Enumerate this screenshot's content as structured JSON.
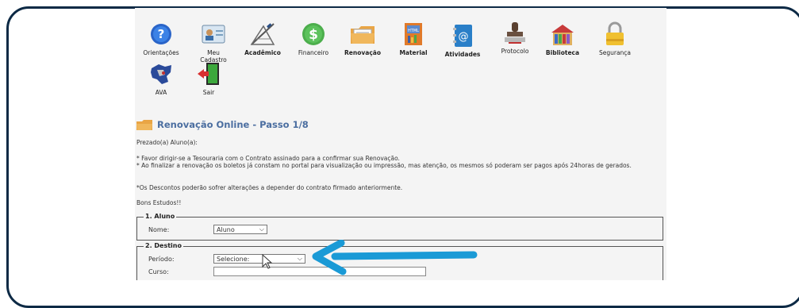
{
  "nav": {
    "items": [
      {
        "label": "Orientações",
        "icon": "help-icon"
      },
      {
        "label": "Meu Cadastro",
        "icon": "id-card-icon"
      },
      {
        "label": "Acadêmico",
        "icon": "drafting-icon"
      },
      {
        "label": "Financeiro",
        "icon": "dollar-icon"
      },
      {
        "label": "Renovação",
        "icon": "folder-icon"
      },
      {
        "label": "Material",
        "icon": "html-book-icon"
      },
      {
        "label": "Atividades",
        "icon": "address-book-icon"
      },
      {
        "label": "Protocolo",
        "icon": "stamp-icon"
      },
      {
        "label": "Biblioteca",
        "icon": "books-icon"
      },
      {
        "label": "Segurança",
        "icon": "padlock-icon"
      },
      {
        "label": "AVA",
        "icon": "map-icon"
      },
      {
        "label": "Sair",
        "icon": "exit-door-icon"
      }
    ]
  },
  "page": {
    "title": "Renovação Online - Passo 1/8",
    "greeting": "Prezado(a) Aluno(a):",
    "notice1": "* Favor dirigir-se a Tesouraria com o Contrato assinado para a confirmar sua Renovação.",
    "notice2": "* Ao finalizar a renovação os boletos já constam no portal para visualização ou impressão, mas atenção, os mesmos só poderam ser pagos após 24horas de gerados.",
    "notice3": "*Os Descontos poderão sofrer alterações a depender do contrato firmado anteriormente.",
    "closing": "Bons Estudos!!"
  },
  "form": {
    "aluno": {
      "legend": "1. Aluno",
      "nome_label": "Nome:",
      "nome_value": "Aluno"
    },
    "destino": {
      "legend": "2. Destino",
      "periodo_label": "Período:",
      "periodo_value": "Selecione:",
      "curso_label": "Curso:"
    }
  },
  "colors": {
    "frame": "#0d2a45",
    "title": "#4b6ea0",
    "arrow": "#1a9ad6"
  }
}
